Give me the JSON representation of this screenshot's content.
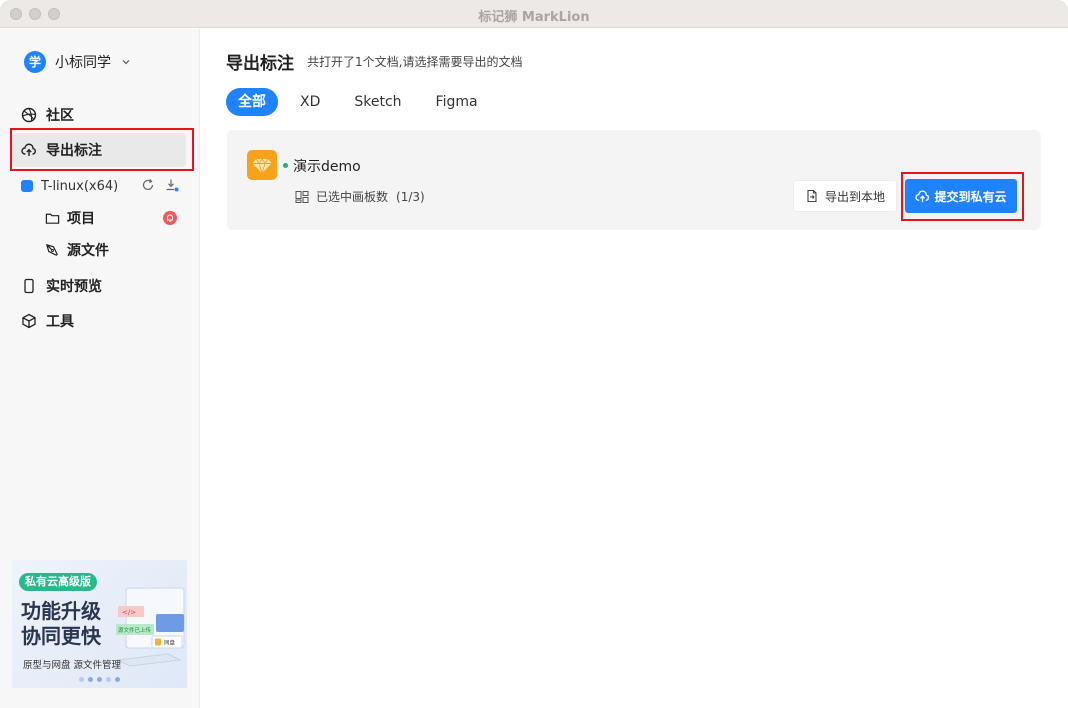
{
  "window": {
    "title": "标记狮 MarkLion"
  },
  "sidebar": {
    "user": {
      "avatar_text": "学",
      "name": "小标同学"
    },
    "nav": [
      {
        "label": "社区",
        "icon": "dribbble-icon"
      },
      {
        "label": "导出标注",
        "icon": "upload-cloud-icon",
        "active": true
      }
    ],
    "project": {
      "name": "T-linux(x64)",
      "items": [
        {
          "label": "项目",
          "icon": "folder-icon"
        },
        {
          "label": "源文件",
          "icon": "pen-icon"
        }
      ]
    },
    "nav_bottom": [
      {
        "label": "实时预览",
        "icon": "phone-icon"
      },
      {
        "label": "工具",
        "icon": "cube-icon"
      }
    ],
    "banner": {
      "pill": "私有云高级版",
      "line1": "功能升级",
      "line2": "协同更快",
      "sub": "原型与网盘   源文件管理",
      "art_tag1": "</>",
      "art_tag2": "源文件已上传",
      "art_tag3": "网盘"
    }
  },
  "main": {
    "title": "导出标注",
    "desc": "共打开了1个文档,请选择需要导出的文档",
    "tabs": [
      "全部",
      "XD",
      "Sketch",
      "Figma"
    ],
    "active_tab": "全部",
    "documents": [
      {
        "name": "演示demo",
        "boards_label": "已选中画板数",
        "boards_count": "(1/3)",
        "export_local_label": "导出到本地",
        "submit_cloud_label": "提交到私有云"
      }
    ]
  },
  "colors": {
    "accent": "#1f82ff",
    "highlight": "#e8131f",
    "sketch": "#f7a21b",
    "online": "#1fb36b"
  }
}
